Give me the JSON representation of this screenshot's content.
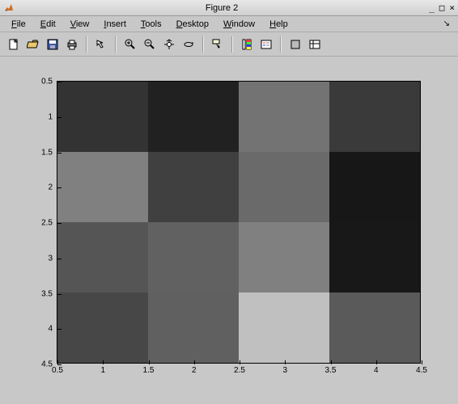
{
  "window": {
    "title": "Figure 2",
    "minimize_glyph": "_",
    "maximize_glyph": "□",
    "close_glyph": "×",
    "corner_glyph": "↘"
  },
  "menu": {
    "items": [
      {
        "label": "File",
        "ul": "F"
      },
      {
        "label": "Edit",
        "ul": "E"
      },
      {
        "label": "View",
        "ul": "V"
      },
      {
        "label": "Insert",
        "ul": "I"
      },
      {
        "label": "Tools",
        "ul": "T"
      },
      {
        "label": "Desktop",
        "ul": "D"
      },
      {
        "label": "Window",
        "ul": "W"
      },
      {
        "label": "Help",
        "ul": "H"
      }
    ]
  },
  "toolbar": {
    "buttons": [
      {
        "name": "new-figure-button",
        "icon": "new-icon"
      },
      {
        "name": "open-button",
        "icon": "open-icon"
      },
      {
        "name": "save-button",
        "icon": "save-icon"
      },
      {
        "name": "print-button",
        "icon": "print-icon"
      },
      {
        "sep": true
      },
      {
        "name": "edit-plot-button",
        "icon": "arrow-icon"
      },
      {
        "sep": true
      },
      {
        "name": "zoom-in-button",
        "icon": "zoom-in-icon"
      },
      {
        "name": "zoom-out-button",
        "icon": "zoom-out-icon"
      },
      {
        "name": "pan-button",
        "icon": "pan-icon"
      },
      {
        "name": "rotate3d-button",
        "icon": "rotate-icon"
      },
      {
        "sep": true
      },
      {
        "name": "data-cursor-button",
        "icon": "datacursor-icon"
      },
      {
        "sep": true
      },
      {
        "name": "insert-colorbar-button",
        "icon": "colorbar-icon"
      },
      {
        "name": "insert-legend-button",
        "icon": "legend-icon"
      },
      {
        "sep": true
      },
      {
        "name": "hide-tools-button",
        "icon": "hidetools-icon"
      },
      {
        "name": "show-tools-button",
        "icon": "showtools-icon"
      }
    ]
  },
  "chart_data": {
    "type": "heatmap",
    "rows": 4,
    "cols": 4,
    "x_ticks": [
      "0.5",
      "1",
      "1.5",
      "2",
      "2.5",
      "3",
      "3.5",
      "4",
      "4.5"
    ],
    "y_ticks": [
      "0.5",
      "1",
      "1.5",
      "2",
      "2.5",
      "3",
      "3.5",
      "4",
      "4.5"
    ],
    "xlim": [
      0.5,
      4.5
    ],
    "ylim": [
      0.5,
      4.5
    ],
    "y_inverted": true,
    "colormap": "gray",
    "cell_colors": [
      [
        "#333333",
        "#212121",
        "#737373",
        "#3a3a3a"
      ],
      [
        "#808080",
        "#404040",
        "#6a6a6a",
        "#171717"
      ],
      [
        "#555555",
        "#616161",
        "#808080",
        "#181818"
      ],
      [
        "#474747",
        "#606060",
        "#c0c0c0",
        "#5a5a5a"
      ]
    ],
    "values_estimate": [
      [
        0.2,
        0.13,
        0.45,
        0.23
      ],
      [
        0.5,
        0.25,
        0.42,
        0.09
      ],
      [
        0.33,
        0.38,
        0.5,
        0.09
      ],
      [
        0.28,
        0.38,
        0.75,
        0.35
      ]
    ]
  }
}
